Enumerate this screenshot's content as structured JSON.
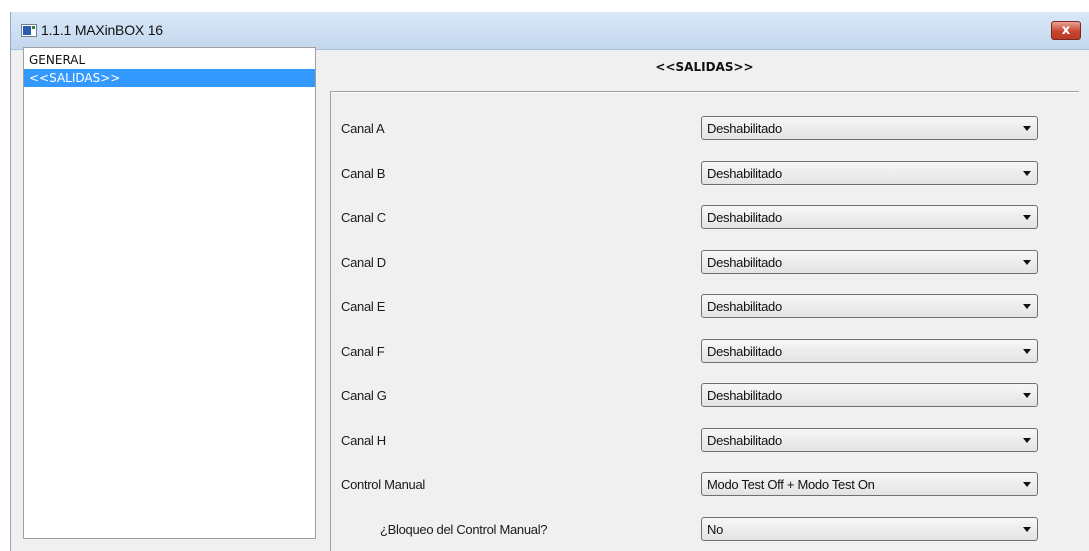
{
  "window": {
    "title": "1.1.1 MAXinBOX 16",
    "close_label": "x"
  },
  "sidebar": {
    "items": [
      {
        "label": "GENERAL",
        "selected": false
      },
      {
        "label": "<<SALIDAS>>",
        "selected": true
      }
    ]
  },
  "main": {
    "section_title": "<<SALIDAS>>",
    "params": [
      {
        "label": "Canal A",
        "value": "Deshabilitado"
      },
      {
        "label": "Canal B",
        "value": "Deshabilitado"
      },
      {
        "label": "Canal C",
        "value": "Deshabilitado"
      },
      {
        "label": "Canal D",
        "value": "Deshabilitado"
      },
      {
        "label": "Canal E",
        "value": "Deshabilitado"
      },
      {
        "label": "Canal F",
        "value": "Deshabilitado"
      },
      {
        "label": "Canal G",
        "value": "Deshabilitado"
      },
      {
        "label": "Canal H",
        "value": "Deshabilitado"
      },
      {
        "label": "Control Manual",
        "value": "Modo Test Off + Modo Test On"
      },
      {
        "label": "¿Bloqueo del Control Manual?",
        "value": "No"
      }
    ]
  },
  "colors": {
    "selection": "#3399ff",
    "close_button": "#c7452e",
    "titlebar": "#c3d7ee"
  },
  "icons": {
    "app": "app-icon",
    "close": "close-icon",
    "dropdown": "chevron-down-icon"
  }
}
